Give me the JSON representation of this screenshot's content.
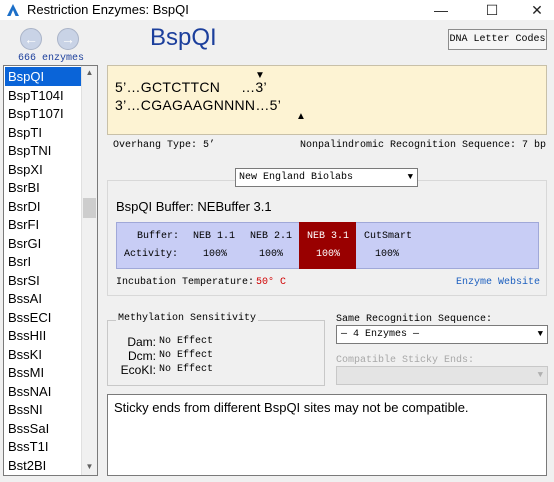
{
  "window": {
    "title": "Restriction Enzymes: BspQI",
    "minimize": "—",
    "maximize": "☐",
    "close": "✕"
  },
  "nav": {
    "back_icon": "arrow-left",
    "forward_icon": "arrow-right",
    "count": "666 enzymes"
  },
  "enzymes": [
    "BspQI",
    "BspT104I",
    "BspT107I",
    "BspTI",
    "BspTNI",
    "BspXI",
    "BsrBI",
    "BsrDI",
    "BsrFI",
    "BsrGI",
    "BsrI",
    "BsrSI",
    "BssAI",
    "BssECI",
    "BssHII",
    "BssKI",
    "BssMI",
    "BssNAI",
    "BssNI",
    "BssSaI",
    "BssT1I",
    "Bst2BI"
  ],
  "selected_enzyme": "BspQI",
  "header": {
    "enzyme_name": "BspQI",
    "dna_button": "DNA Letter Codes"
  },
  "sequence": {
    "top": "5’…GCTCTTCN     …3’",
    "bottom": "3’…CGAGAAGNNNN…5’",
    "top_cut": "▼",
    "bottom_cut": "▲"
  },
  "info": {
    "overhang": "Overhang Type: 5’",
    "recognition": "Nonpalindromic Recognition Sequence: 7 bp"
  },
  "supplier": {
    "selected": "New England Biolabs"
  },
  "buffer": {
    "title": "BspQI Buffer: NEBuffer 3.1",
    "row_labels": [
      "Buffer:",
      "Activity:"
    ],
    "columns": [
      {
        "name": "NEB 1.1",
        "activity": "100%"
      },
      {
        "name": "NEB 2.1",
        "activity": "100%"
      },
      {
        "name": "NEB 3.1",
        "activity": "100%"
      },
      {
        "name": "CutSmart",
        "activity": "100%"
      }
    ],
    "highlight_color": "#990000",
    "table_color": "#c8cdf5",
    "incubation_label": "Incubation Temperature:",
    "incubation_value": "50° C",
    "incubation_color": "#d00000",
    "website_link": "Enzyme Website"
  },
  "methylation": {
    "title": "Methylation Sensitivity",
    "rows": [
      {
        "label": "Dam:",
        "value": "No Effect"
      },
      {
        "label": "Dcm:",
        "value": "No Effect"
      },
      {
        "label": "EcoKI:",
        "value": "No Effect"
      }
    ]
  },
  "same_recognition": {
    "label": "Same Recognition Sequence:",
    "value": "— 4 Enzymes —"
  },
  "sticky_ends": {
    "label": "Compatible Sticky Ends:",
    "value": ""
  },
  "notes": "Sticky ends from different BspQI sites may not be compatible.",
  "colors": {
    "accent": "#1c3f9c",
    "selection": "#0a64d8",
    "sequence_bg": "#fdf3d3"
  }
}
